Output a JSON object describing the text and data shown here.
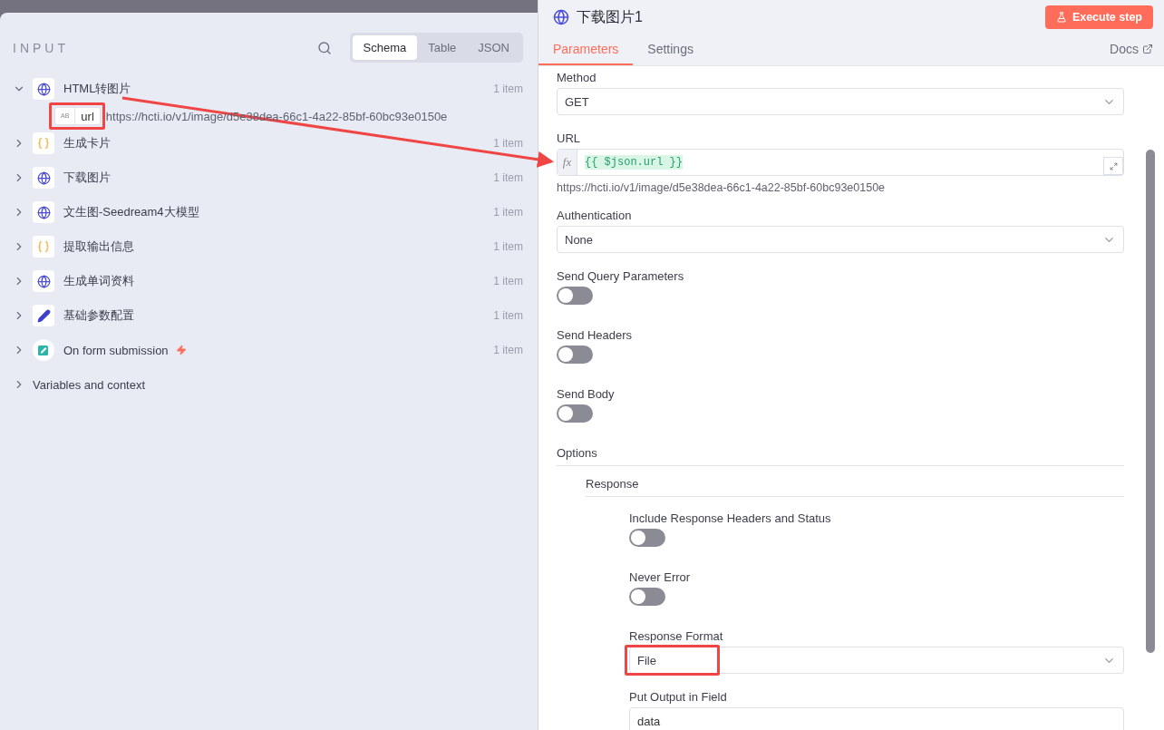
{
  "input_panel": {
    "title": "INPUT",
    "view_tabs": [
      {
        "label": "Schema",
        "selected": true
      },
      {
        "label": "Table",
        "selected": false
      },
      {
        "label": "JSON",
        "selected": false
      }
    ],
    "nodes": [
      {
        "kind": "globe",
        "label": "HTML转图片",
        "count": "1 item",
        "expanded": true,
        "trigger": false,
        "children": [
          {
            "type": "AB",
            "name": "url",
            "value": "https://hcti.io/v1/image/d5e38dea-66c1-4a22-85bf-60bc93e0150e",
            "highlighted": true
          }
        ]
      },
      {
        "kind": "braces",
        "label": "生成卡片",
        "count": "1 item",
        "expanded": false,
        "trigger": false
      },
      {
        "kind": "globe",
        "label": "下载图片",
        "count": "1 item",
        "expanded": false,
        "trigger": false
      },
      {
        "kind": "globe",
        "label": "文生图-Seedream4大模型",
        "count": "1 item",
        "expanded": false,
        "trigger": false
      },
      {
        "kind": "braces",
        "label": "提取输出信息",
        "count": "1 item",
        "expanded": false,
        "trigger": false
      },
      {
        "kind": "globe",
        "label": "生成单词资料",
        "count": "1 item",
        "expanded": false,
        "trigger": false
      },
      {
        "kind": "pencil",
        "label": "基础参数配置",
        "count": "1 item",
        "expanded": false,
        "trigger": false
      },
      {
        "kind": "form",
        "label": "On form submission",
        "count": "1 item",
        "expanded": false,
        "trigger": true
      }
    ],
    "variables": {
      "label": "Variables and context",
      "expanded": false
    }
  },
  "node_panel": {
    "title": "下载图片1",
    "execute_button": "Execute step",
    "tabs": [
      {
        "label": "Parameters",
        "selected": true
      },
      {
        "label": "Settings",
        "selected": false
      }
    ],
    "docs_link": "Docs",
    "parameters": [
      {
        "kind": "select",
        "label": "Method",
        "value": "GET"
      },
      {
        "kind": "expression",
        "label": "URL",
        "prefix": "fx",
        "value": "{{ $json.url }}",
        "hint": "https://hcti.io/v1/image/d5e38dea-66c1-4a22-85bf-60bc93e0150e"
      },
      {
        "kind": "select",
        "label": "Authentication",
        "value": "None"
      },
      {
        "kind": "toggle",
        "label": "Send Query Parameters",
        "on": false
      },
      {
        "kind": "toggle",
        "label": "Send Headers",
        "on": false
      },
      {
        "kind": "toggle",
        "label": "Send Body",
        "on": false
      }
    ],
    "options": {
      "title": "Options",
      "groups": [
        {
          "title": "Response",
          "fields": [
            {
              "kind": "toggle",
              "label": "Include Response Headers and Status",
              "on": false
            },
            {
              "kind": "toggle",
              "label": "Never Error",
              "on": false
            },
            {
              "kind": "select",
              "label": "Response Format",
              "value": "File",
              "highlighted": true
            },
            {
              "kind": "text",
              "label": "Put Output in Field",
              "value": "data"
            }
          ]
        }
      ]
    }
  }
}
